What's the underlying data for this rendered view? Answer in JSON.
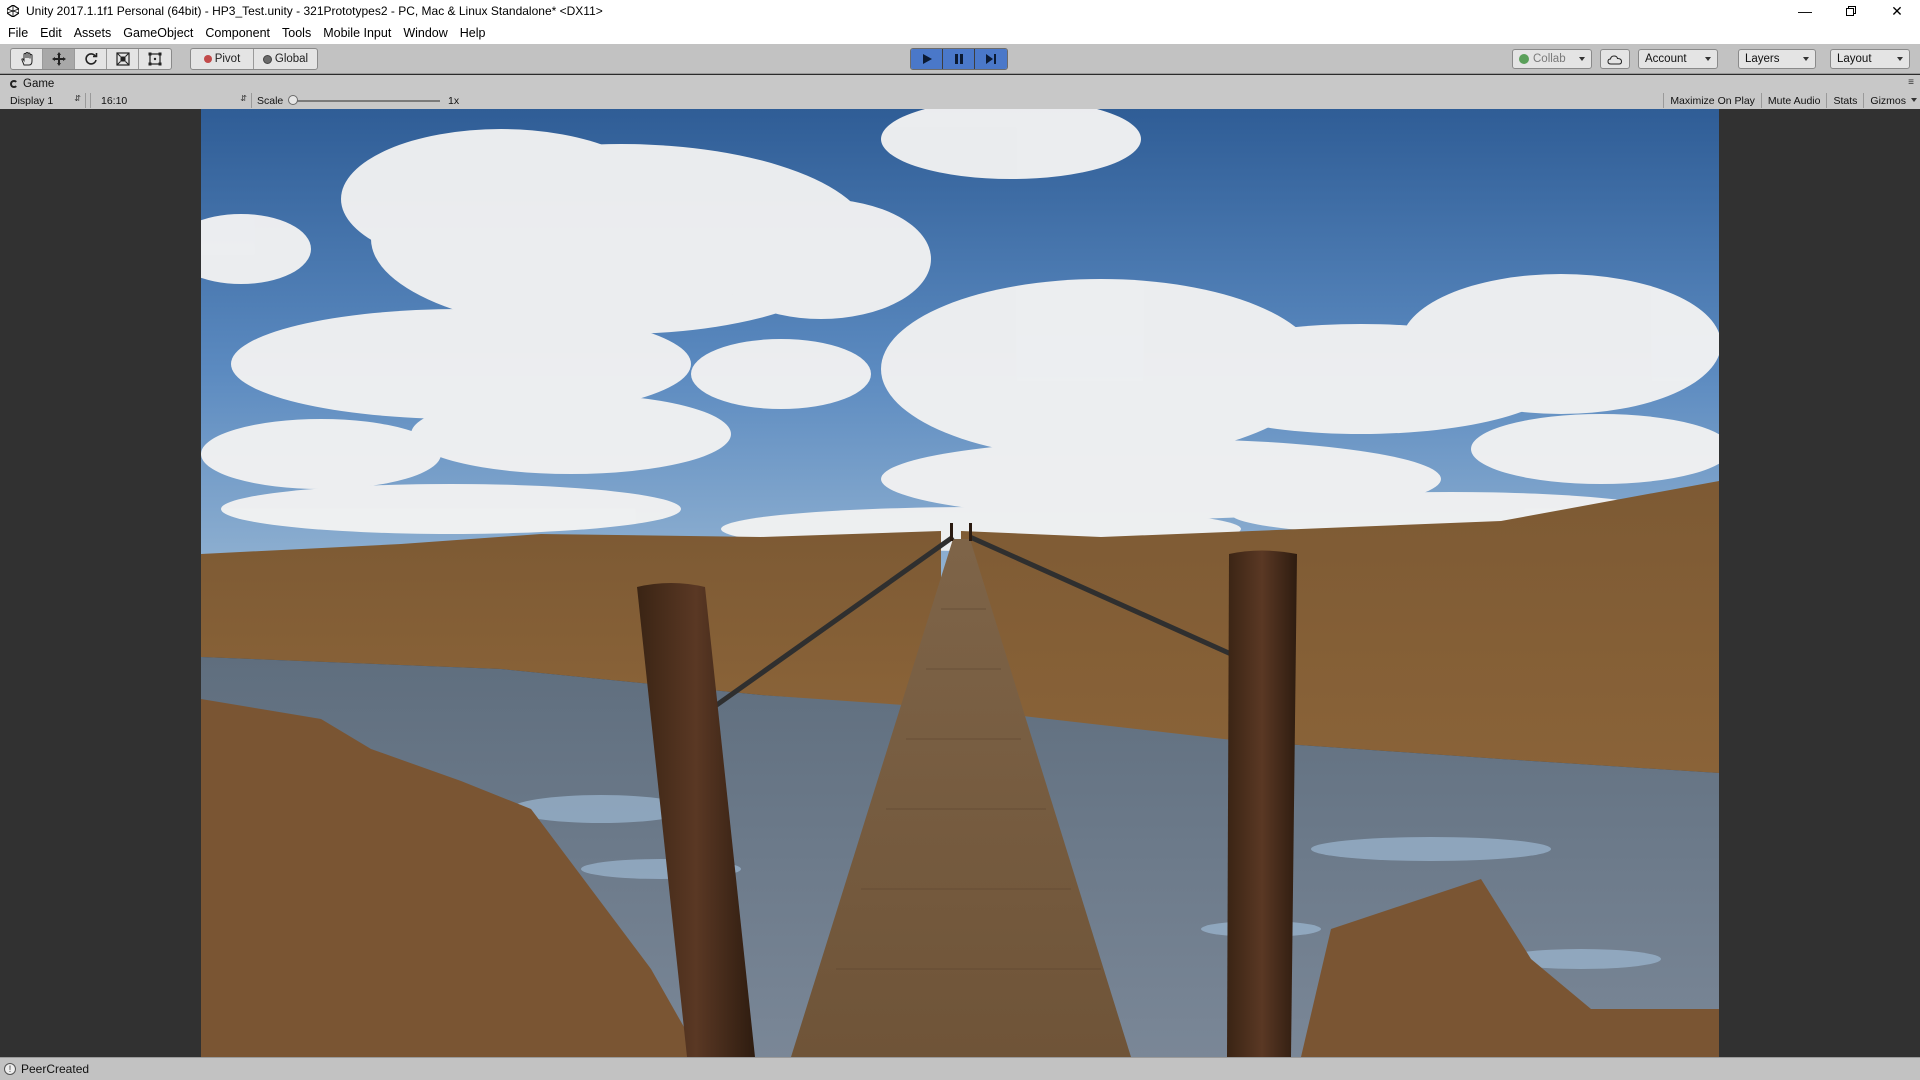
{
  "window": {
    "title": "Unity 2017.1.1f1 Personal (64bit) - HP3_Test.unity - 321Prototypes2 - PC, Mac & Linux Standalone* <DX11>",
    "minimize_icon": "minimize-icon",
    "restore_icon": "restore-icon",
    "close_icon": "close-icon"
  },
  "menu": {
    "items": [
      "File",
      "Edit",
      "Assets",
      "GameObject",
      "Component",
      "Tools",
      "Mobile Input",
      "Window",
      "Help"
    ]
  },
  "toolbar": {
    "tools": [
      "hand-icon",
      "move-icon",
      "rotate-icon",
      "scale-icon",
      "rect-icon"
    ],
    "pivot_label": "Pivot",
    "global_label": "Global",
    "collab_label": "Collab",
    "account_label": "Account",
    "layers_label": "Layers",
    "layout_label": "Layout",
    "play_active_color": "#4a78c9"
  },
  "game_view": {
    "tab_label": "Game",
    "display_label": "Display 1",
    "aspect_label": "16:10",
    "scale_label": "Scale",
    "scale_value": "1x",
    "scale_fraction": 0.0,
    "toggles": [
      "Maximize On Play",
      "Mute Audio",
      "Stats",
      "Gizmos"
    ]
  },
  "status": {
    "message": "PeerCreated"
  }
}
